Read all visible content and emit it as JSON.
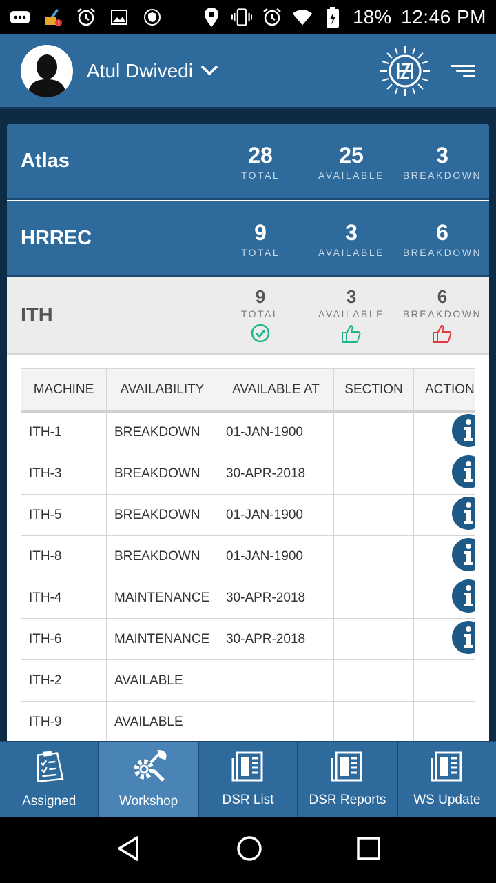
{
  "status_bar": {
    "battery": "18%",
    "time": "12:46 PM",
    "icons": [
      "message-icon",
      "cleaner-icon",
      "alarm-icon",
      "image-icon",
      "shield-icon",
      "location-icon",
      "vibrate-icon",
      "alarm-icon",
      "wifi-icon",
      "battery-icon"
    ]
  },
  "header": {
    "user_name": "Atul Dwivedi",
    "colors": {
      "primary": "#2e6a9c",
      "dark": "#0d2b45"
    }
  },
  "summaries": [
    {
      "title": "Atlas",
      "total": "28",
      "available": "25",
      "breakdown": "3"
    },
    {
      "title": "HRREC",
      "total": "9",
      "available": "3",
      "breakdown": "6"
    },
    {
      "title": "ITH",
      "total": "9",
      "available": "3",
      "breakdown": "6"
    }
  ],
  "labels": {
    "total": "TOTAL",
    "available": "AVAILABLE",
    "breakdown": "BREAKDOWN"
  },
  "table": {
    "headers": [
      "MACHINE",
      "AVAILABILITY",
      "AVAILABLE AT",
      "SECTION",
      "ACTION"
    ],
    "rows": [
      {
        "machine": "ITH-1",
        "availability": "BREAKDOWN",
        "available_at": "01-JAN-1900",
        "section": "",
        "action": "info"
      },
      {
        "machine": "ITH-3",
        "availability": "BREAKDOWN",
        "available_at": "30-APR-2018",
        "section": "",
        "action": "info"
      },
      {
        "machine": "ITH-5",
        "availability": "BREAKDOWN",
        "available_at": "01-JAN-1900",
        "section": "",
        "action": "info"
      },
      {
        "machine": "ITH-8",
        "availability": "BREAKDOWN",
        "available_at": "01-JAN-1900",
        "section": "",
        "action": "info"
      },
      {
        "machine": "ITH-4",
        "availability": "MAINTENANCE",
        "available_at": "30-APR-2018",
        "section": "",
        "action": "info"
      },
      {
        "machine": "ITH-6",
        "availability": "MAINTENANCE",
        "available_at": "30-APR-2018",
        "section": "",
        "action": "info"
      },
      {
        "machine": "ITH-2",
        "availability": "AVAILABLE",
        "available_at": "",
        "section": "",
        "action": ""
      },
      {
        "machine": "ITH-9",
        "availability": "AVAILABLE",
        "available_at": "",
        "section": "",
        "action": ""
      }
    ]
  },
  "bottom_nav": [
    {
      "label": "Assigned",
      "icon": "clipboard-icon",
      "active": false
    },
    {
      "label": "Workshop",
      "icon": "tools-icon",
      "active": true
    },
    {
      "label": "DSR List",
      "icon": "newspaper-icon",
      "active": false
    },
    {
      "label": "DSR Reports",
      "icon": "newspaper-icon",
      "active": false
    },
    {
      "label": "WS Update",
      "icon": "newspaper-icon",
      "active": false
    }
  ]
}
